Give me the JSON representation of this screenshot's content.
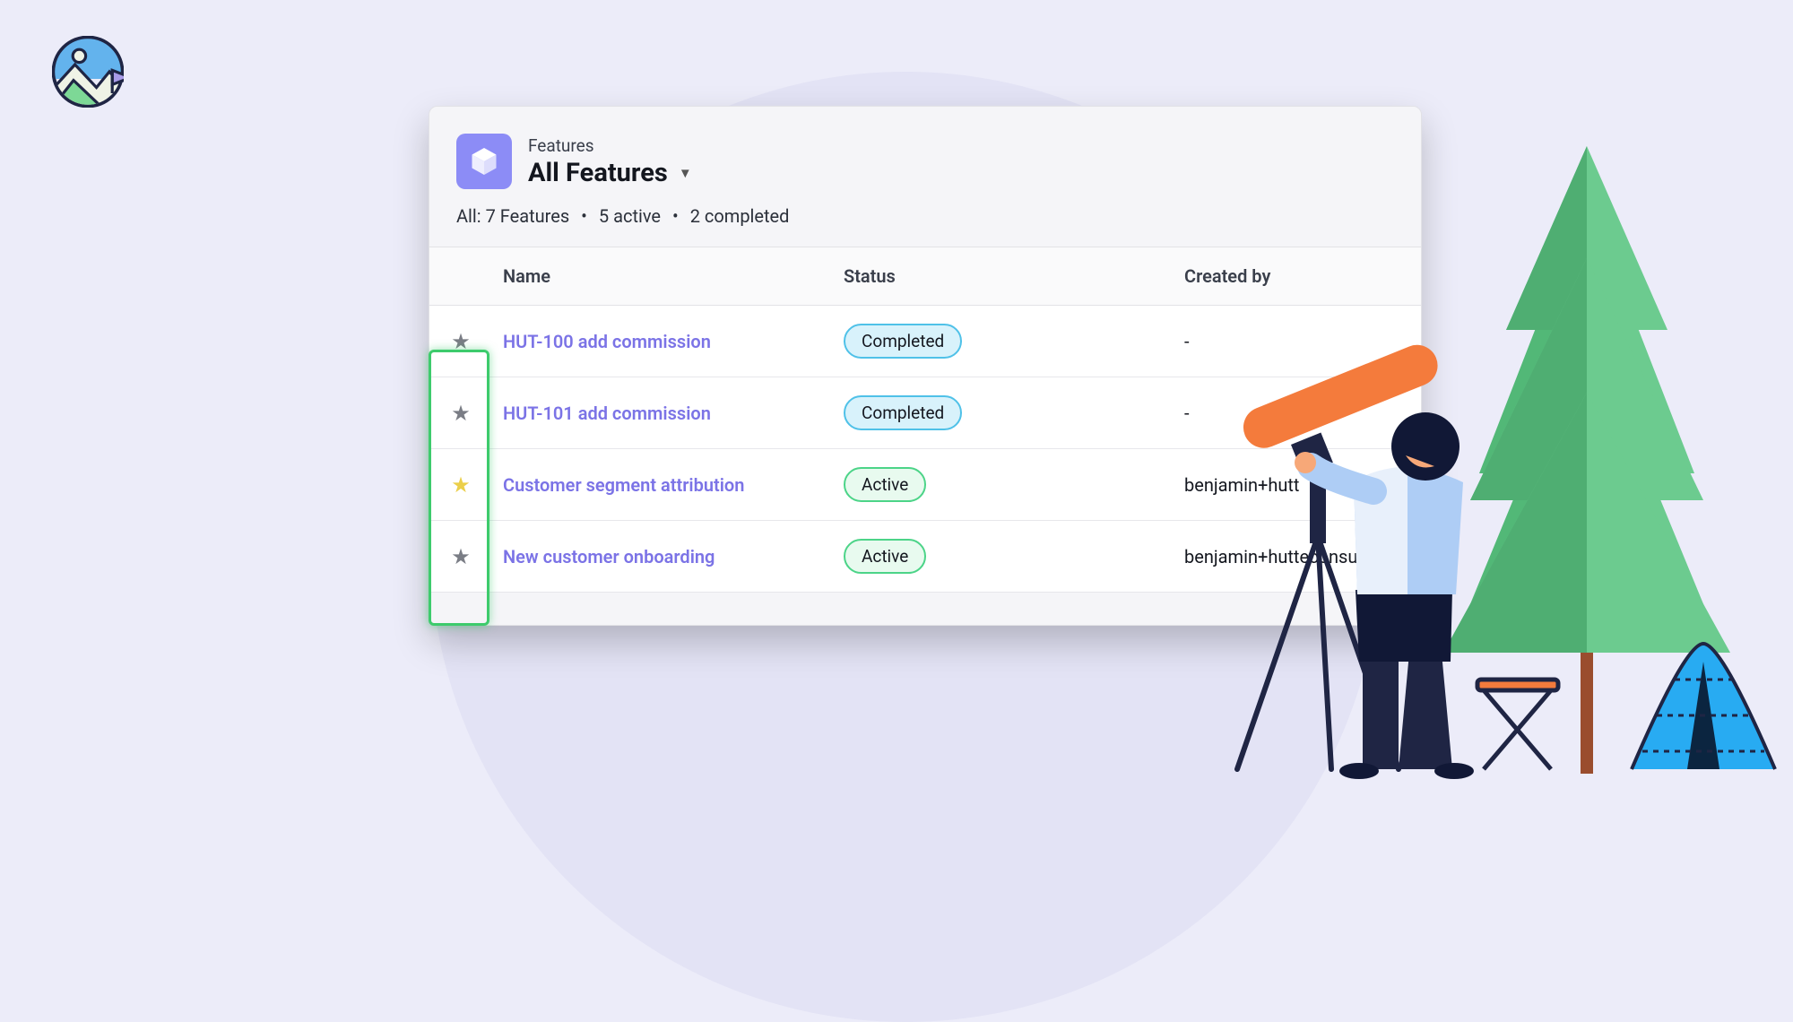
{
  "header": {
    "breadcrumb": "Features",
    "title": "All Features",
    "stats_all": "All: 7 Features",
    "stats_active": "5 active",
    "stats_completed": "2 completed"
  },
  "columns": {
    "name": "Name",
    "status": "Status",
    "created_by": "Created by"
  },
  "status_labels": {
    "completed": "Completed",
    "active": "Active"
  },
  "rows": [
    {
      "starred": false,
      "name": "HUT-100 add commission",
      "status": "completed",
      "created_by": "-"
    },
    {
      "starred": false,
      "name": "HUT-101 add commission",
      "status": "completed",
      "created_by": "-"
    },
    {
      "starred": true,
      "name": "Customer segment attribution",
      "status": "active",
      "created_by": "benjamin+hutt"
    },
    {
      "starred": false,
      "name": "New customer onboarding",
      "status": "active",
      "created_by": "benjamin+hutteconsu"
    }
  ]
}
